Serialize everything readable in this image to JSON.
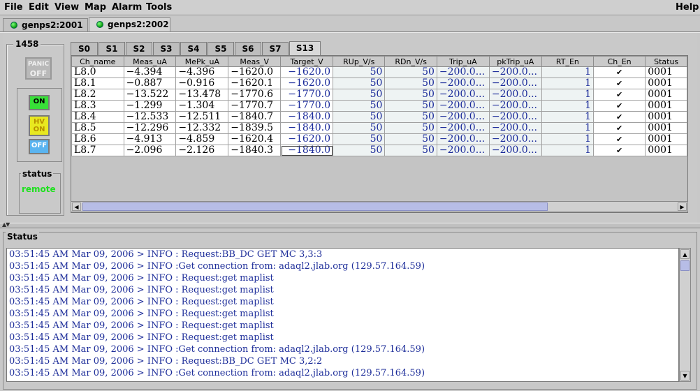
{
  "menu": {
    "file": "File",
    "edit": "Edit",
    "view": "View",
    "map": "Map",
    "alarm": "Alarm",
    "tools": "Tools",
    "help": "Help"
  },
  "connections": [
    {
      "label": "genps2:2001",
      "status": "connected"
    },
    {
      "label": "genps2:2002",
      "status": "connected"
    }
  ],
  "crate": {
    "id": "1458",
    "panic_label_1": "PANIC",
    "panic_label_2": "OFF",
    "on_label": "ON",
    "hv_on_label_1": "HV",
    "hv_on_label_2": "ON",
    "off_label": "OFF",
    "status_title": "status",
    "status_value": "remote"
  },
  "slot_tabs": [
    "S0",
    "S1",
    "S2",
    "S3",
    "S4",
    "S5",
    "S6",
    "S7",
    "S13"
  ],
  "active_slot": "S13",
  "table": {
    "columns": [
      "Ch_name",
      "Meas_uA",
      "MePk_uA",
      "Meas_V",
      "Target_V",
      "RUp_V/s",
      "RDn_V/s",
      "Trip_uA",
      "pkTrip_uA",
      "RT_En",
      "Ch_En",
      "Status"
    ],
    "rows": [
      [
        "L8.0",
        "−4.394",
        "−4.396",
        "−1620.0",
        "−1620.0",
        "50",
        "50",
        "−200.0...",
        "−200.0...",
        "1",
        "✔",
        "0001"
      ],
      [
        "L8.1",
        "−0.887",
        "−0.916",
        "−1620.1",
        "−1620.0",
        "50",
        "50",
        "−200.0...",
        "−200.0...",
        "1",
        "✔",
        "0001"
      ],
      [
        "L8.2",
        "−13.522",
        "−13.478",
        "−1770.6",
        "−1770.0",
        "50",
        "50",
        "−200.0...",
        "−200.0...",
        "1",
        "✔",
        "0001"
      ],
      [
        "L8.3",
        "−1.299",
        "−1.304",
        "−1770.7",
        "−1770.0",
        "50",
        "50",
        "−200.0...",
        "−200.0...",
        "1",
        "✔",
        "0001"
      ],
      [
        "L8.4",
        "−12.533",
        "−12.511",
        "−1840.7",
        "−1840.0",
        "50",
        "50",
        "−200.0...",
        "−200.0...",
        "1",
        "✔",
        "0001"
      ],
      [
        "L8.5",
        "−12.296",
        "−12.332",
        "−1839.5",
        "−1840.0",
        "50",
        "50",
        "−200.0...",
        "−200.0...",
        "1",
        "✔",
        "0001"
      ],
      [
        "L8.6",
        "−4.913",
        "−4.859",
        "−1620.4",
        "−1620.0",
        "50",
        "50",
        "−200.0...",
        "−200.0...",
        "1",
        "✔",
        "0001"
      ],
      [
        "L8.7",
        "−2.096",
        "−2.126",
        "−1840.3",
        "−1840.0",
        "50",
        "50",
        "−200.0...",
        "−200.0...",
        "1",
        "✔",
        "0001"
      ]
    ]
  },
  "status_panel": {
    "title": "Status",
    "log": [
      "03:51:45 AM Mar 09, 2006 > INFO : Request:BB_DC GET MC 3,3:3",
      "03:51:45 AM Mar 09, 2006 > INFO :Get connection from: adaql2.jlab.org (129.57.164.59)",
      "03:51:45 AM Mar 09, 2006 > INFO : Request:get maplist",
      "03:51:45 AM Mar 09, 2006 > INFO : Request:get maplist",
      "03:51:45 AM Mar 09, 2006 > INFO : Request:get maplist",
      "03:51:45 AM Mar 09, 2006 > INFO : Request:get maplist",
      "03:51:45 AM Mar 09, 2006 > INFO : Request:get maplist",
      "03:51:45 AM Mar 09, 2006 > INFO : Request:get maplist",
      "03:51:45 AM Mar 09, 2006 > INFO :Get connection from: adaql2.jlab.org (129.57.164.59)",
      "03:51:45 AM Mar 09, 2006 > INFO : Request:BB_DC GET MC 3,2:2",
      "03:51:45 AM Mar 09, 2006 > INFO :Get connection from: adaql2.jlab.org (129.57.164.59)"
    ]
  },
  "colors": {
    "led_on": "#1fbf1f",
    "log_text": "#1e2e9a",
    "status_remote": "#20e020",
    "on_button": "#38e038",
    "hv_on_button": "#e8e820",
    "off_button": "#5ab4f0"
  }
}
